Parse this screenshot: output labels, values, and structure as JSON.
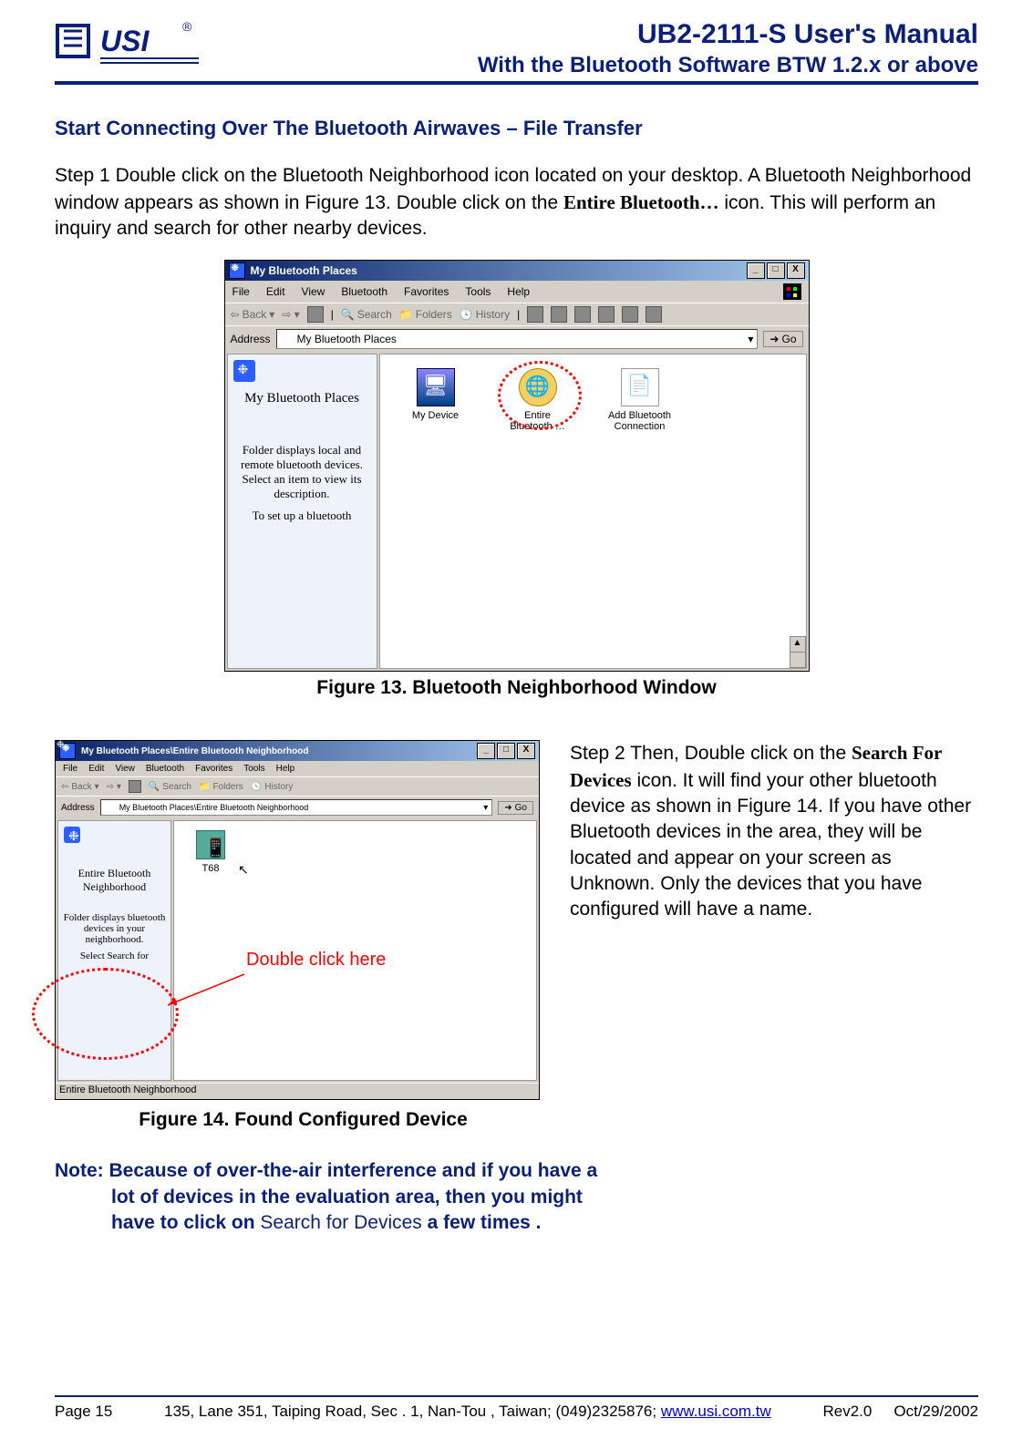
{
  "header": {
    "title": "UB2-2111-S User's Manual",
    "subtitle": "With the Bluetooth Software BTW 1.2.x or above"
  },
  "section_heading": "Start Connecting Over The Bluetooth Airwaves – File Transfer",
  "step1": {
    "label": "Step 1",
    "text_a": "Double click on the Bluetooth Neighborhood icon located on your desktop. A Bluetooth Neighborhood window appears as shown in Figure 13. Double click on the ",
    "bold": "Entire Bluetooth…",
    "text_b": " icon. This will perform an inquiry and search for other nearby devices."
  },
  "figure13": {
    "caption": "Figure 13. Bluetooth Neighborhood Window",
    "window": {
      "title": "My Bluetooth Places",
      "menus": [
        "File",
        "Edit",
        "View",
        "Bluetooth",
        "Favorites",
        "Tools",
        "Help"
      ],
      "toolbar": {
        "back": "Back",
        "search": "Search",
        "folders": "Folders",
        "history": "History"
      },
      "address_label": "Address",
      "address_value": "My Bluetooth Places",
      "go": "Go",
      "side": {
        "heading": "My Bluetooth Places",
        "desc1": "Folder displays local and remote bluetooth devices. Select an item to view its description.",
        "desc2": "To set up a bluetooth"
      },
      "icons": [
        {
          "name": "My Device"
        },
        {
          "name": "Entire Bluetooth …"
        },
        {
          "name": "Add Bluetooth Connection"
        }
      ]
    }
  },
  "step2": {
    "label": "Step 2",
    "text_a": "Then, Double click on the ",
    "bold": "Search For Devices",
    "text_b": " icon. It will find your other bluetooth device as shown in Figure 14. If you have other Bluetooth devices in the area, they will be located and appear on your screen as Unknown. Only the devices that you have configured will have a name."
  },
  "figure14": {
    "caption": "Figure 14. Found Configured Device",
    "annotation": "Double click here",
    "window": {
      "title": "My Bluetooth Places\\Entire Bluetooth Neighborhood",
      "menus": [
        "File",
        "Edit",
        "View",
        "Bluetooth",
        "Favorites",
        "Tools",
        "Help"
      ],
      "toolbar": {
        "back": "Back",
        "search": "Search",
        "folders": "Folders",
        "history": "History"
      },
      "address_label": "Address",
      "address_value": "My Bluetooth Places\\Entire Bluetooth Neighborhood",
      "go": "Go",
      "side": {
        "heading": "Entire Bluetooth Neighborhood",
        "desc1": "Folder displays bluetooth devices in your neighborhood.",
        "desc2": "Select Search for"
      },
      "status": "Entire Bluetooth Neighborhood",
      "device": "T68"
    }
  },
  "note": {
    "label": "Note:",
    "text_a": "Because of over-the-air interference and if you have a lot of devices in the evaluation area, then you might have to click on ",
    "plain": "Search for Devices",
    "text_b": " a few times ."
  },
  "footer": {
    "page": "Page 15",
    "address": "135, Lane 351, Taiping Road, Sec . 1, Nan-Tou , Taiwan; (049)2325876; ",
    "link": "www.usi.com.tw",
    "rev": "Rev2.0",
    "date": "Oct/29/2002"
  }
}
